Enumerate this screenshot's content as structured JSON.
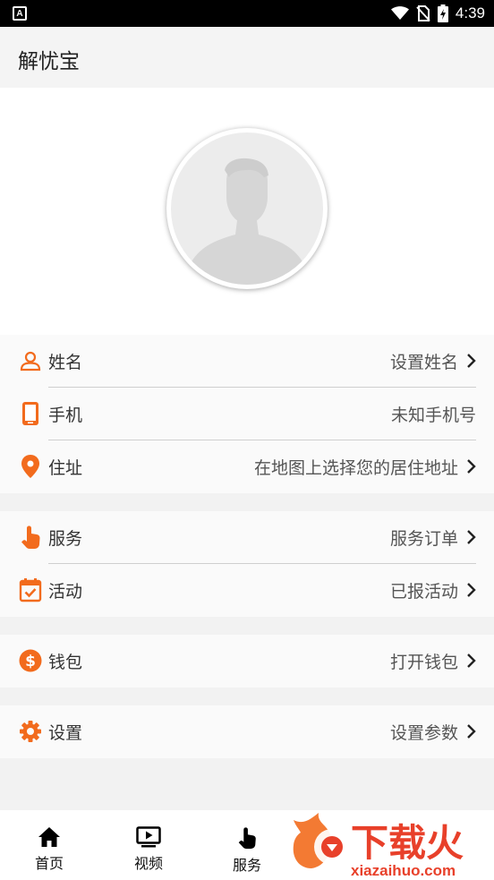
{
  "status_bar": {
    "time": "4:39",
    "left_icon_letter": "A"
  },
  "app_bar": {
    "title": "解忧宝"
  },
  "profile": {
    "avatar": "default-user-avatar"
  },
  "sections": [
    {
      "rows": [
        {
          "icon": "person-icon",
          "label": "姓名",
          "value": "设置姓名",
          "chevron": true
        },
        {
          "icon": "phone-icon",
          "label": "手机",
          "value": "未知手机号",
          "chevron": false
        },
        {
          "icon": "location-pin-icon",
          "label": "住址",
          "value": "在地图上选择您的居住地址",
          "chevron": true
        }
      ]
    },
    {
      "rows": [
        {
          "icon": "tap-hand-icon",
          "label": "服务",
          "value": "服务订单",
          "chevron": true
        },
        {
          "icon": "calendar-check-icon",
          "label": "活动",
          "value": "已报活动",
          "chevron": true
        }
      ]
    },
    {
      "rows": [
        {
          "icon": "dollar-coin-icon",
          "label": "钱包",
          "value": "打开钱包",
          "chevron": true
        }
      ]
    },
    {
      "rows": [
        {
          "icon": "gear-icon",
          "label": "设置",
          "value": "设置参数",
          "chevron": true
        }
      ]
    }
  ],
  "bottom_nav": [
    {
      "icon": "home-icon",
      "label": "首页"
    },
    {
      "icon": "video-play-icon",
      "label": "视频"
    },
    {
      "icon": "tap-hand-icon",
      "label": "服务"
    }
  ],
  "watermark": {
    "text_cn": "下载火",
    "text_url": "xiazaihuo.com"
  },
  "colors": {
    "accent": "#f26b1d",
    "status_bar": "#000000",
    "app_bar": "#f4f4f4",
    "row_bg": "#fafafa",
    "separator": "#cfcfcf"
  }
}
